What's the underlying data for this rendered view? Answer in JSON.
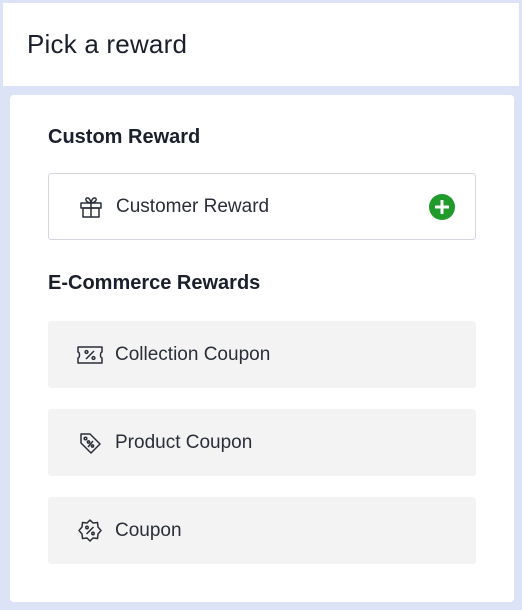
{
  "header": {
    "title": "Pick a reward"
  },
  "sections": {
    "custom": {
      "title": "Custom Reward",
      "items": [
        {
          "label": "Customer Reward",
          "icon": "gift-icon",
          "action_icon": "add-circle-icon"
        }
      ]
    },
    "ecommerce": {
      "title": "E-Commerce Rewards",
      "items": [
        {
          "label": "Collection Coupon",
          "icon": "ticket-percent-icon"
        },
        {
          "label": "Product Coupon",
          "icon": "tag-percent-icon"
        },
        {
          "label": "Coupon",
          "icon": "badge-percent-icon"
        }
      ]
    }
  },
  "colors": {
    "background": "#dde3f6",
    "accent_green": "#1f9a2b",
    "card_fill": "#f3f3f3"
  }
}
